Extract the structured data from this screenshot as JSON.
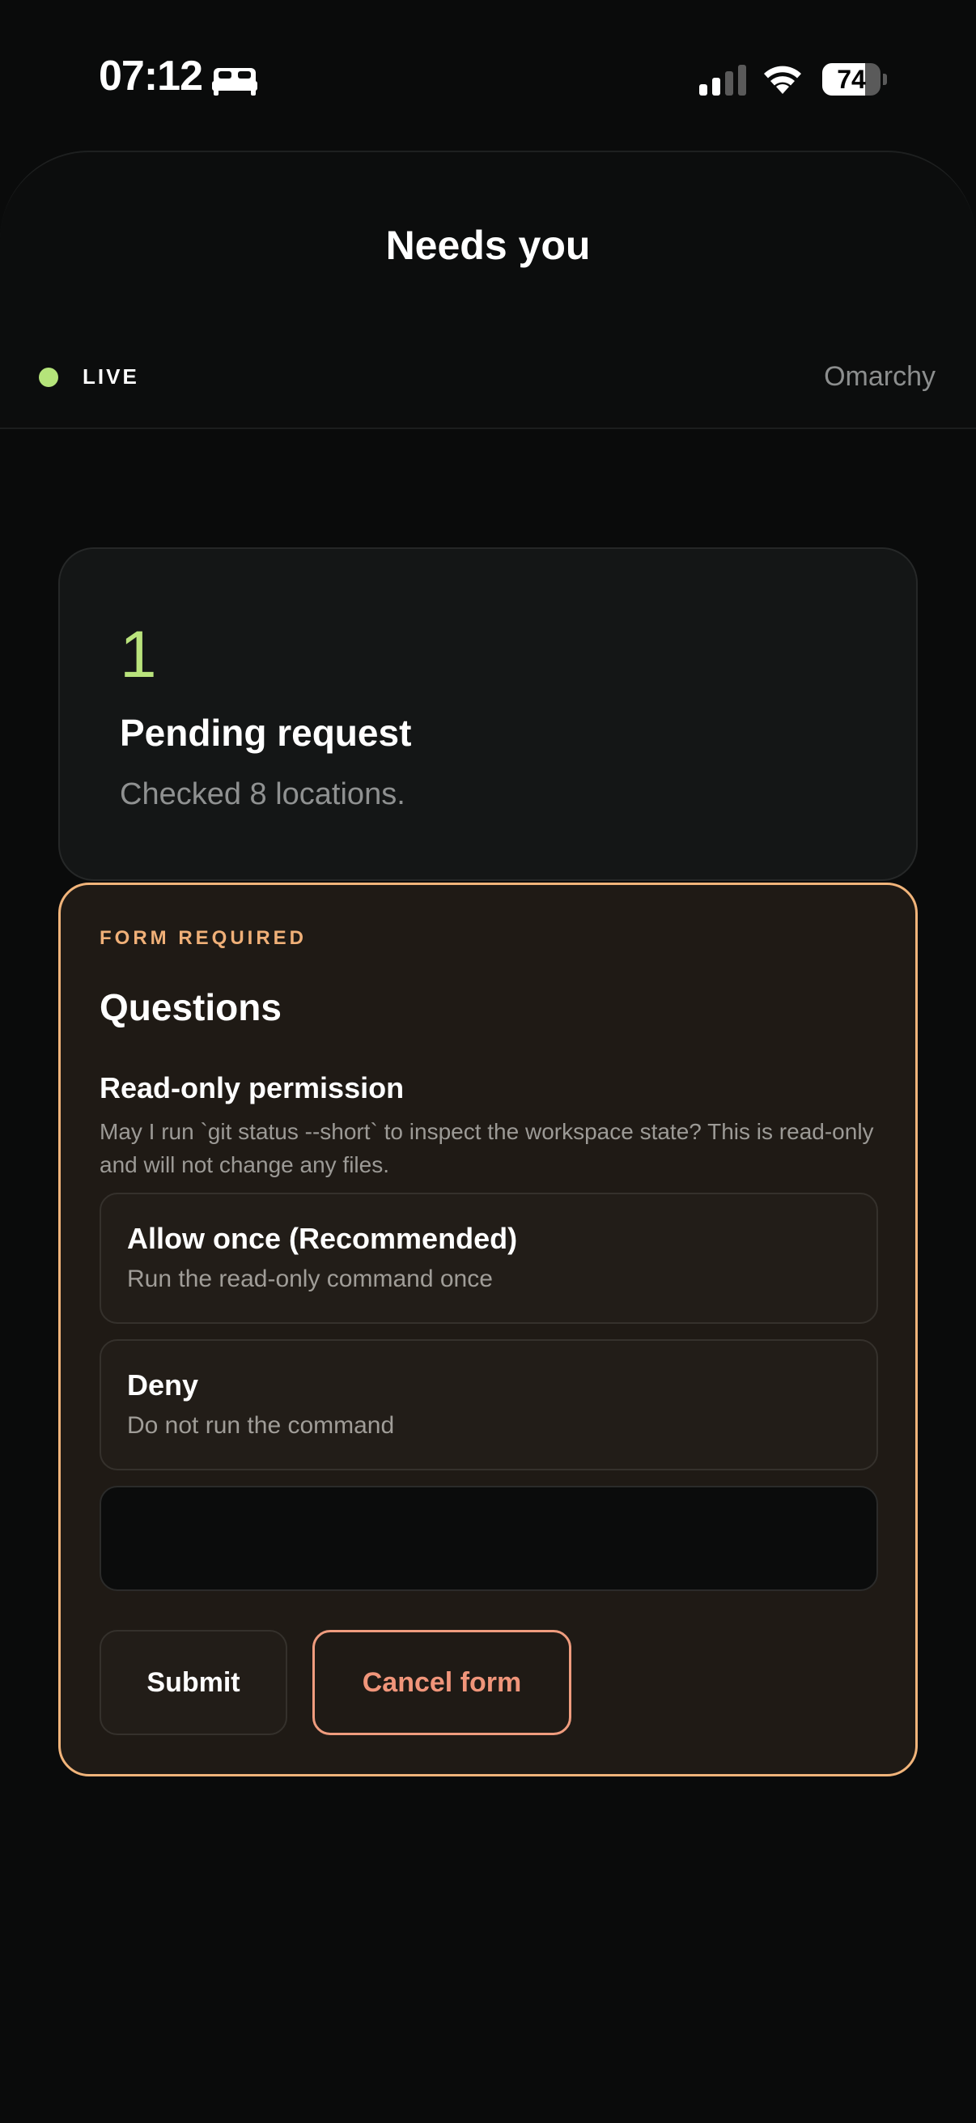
{
  "status_bar": {
    "time": "07:12",
    "focus_icon": "bed-icon",
    "battery_level": "74",
    "battery_fraction": 0.74
  },
  "header": {
    "title": "Needs you",
    "live_label": "LIVE",
    "host_name": "Omarchy",
    "live_color": "#b5e47a"
  },
  "summary": {
    "count": "1",
    "title": "Pending request",
    "subtitle": "Checked 8 locations."
  },
  "form": {
    "kicker": "FORM REQUIRED",
    "title": "Questions",
    "question": {
      "title": "Read-only permission",
      "description": "May I run `git status --short` to inspect the workspace state? This is read-only and will not change any files."
    },
    "options": [
      {
        "label": "Allow once (Recommended)",
        "description": "Run the read-only command once"
      },
      {
        "label": "Deny",
        "description": "Do not run the command"
      }
    ],
    "free_input": {
      "value": "",
      "placeholder": ""
    },
    "submit_label": "Submit",
    "cancel_label": "Cancel form",
    "accent_color": "#f1b47a",
    "cancel_color": "#ef9c7e"
  }
}
